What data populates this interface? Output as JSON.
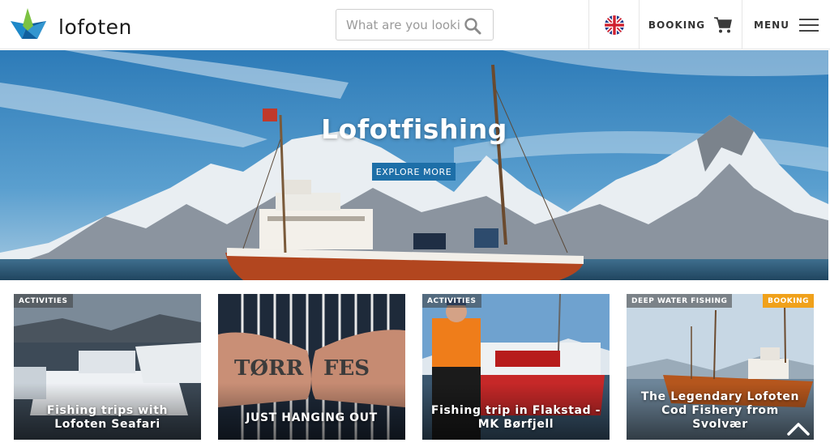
{
  "header": {
    "brand": "lofoten",
    "search_placeholder": "What are you looking for?",
    "booking_label": "BOOKING",
    "menu_label": "MENU",
    "icons": {
      "search": "search-icon",
      "cart": "cart-icon",
      "menu": "hamburger-icon",
      "language": "uk-flag-icon"
    }
  },
  "hero": {
    "title": "Lofotfishing",
    "button_label": "EXPLORE MORE"
  },
  "cards": [
    {
      "tag": "ACTIVITIES",
      "title": "Fishing trips with Lofoten Seafari"
    },
    {
      "tag": "",
      "title": "JUST HANGING OUT"
    },
    {
      "tag": "ACTIVITIES",
      "title": "Fishing trip in Flakstad - MK Børfjell"
    },
    {
      "tag": "DEEP WATER FISHING",
      "badge": "BOOKING",
      "title": "The Legendary Lofoten Cod Fishery from Svolvær"
    }
  ],
  "colors": {
    "accent": "#1d6fa8",
    "booking_badge": "#f0a11b",
    "logo_green": "#7cc242",
    "logo_blue": "#1e88c8"
  }
}
